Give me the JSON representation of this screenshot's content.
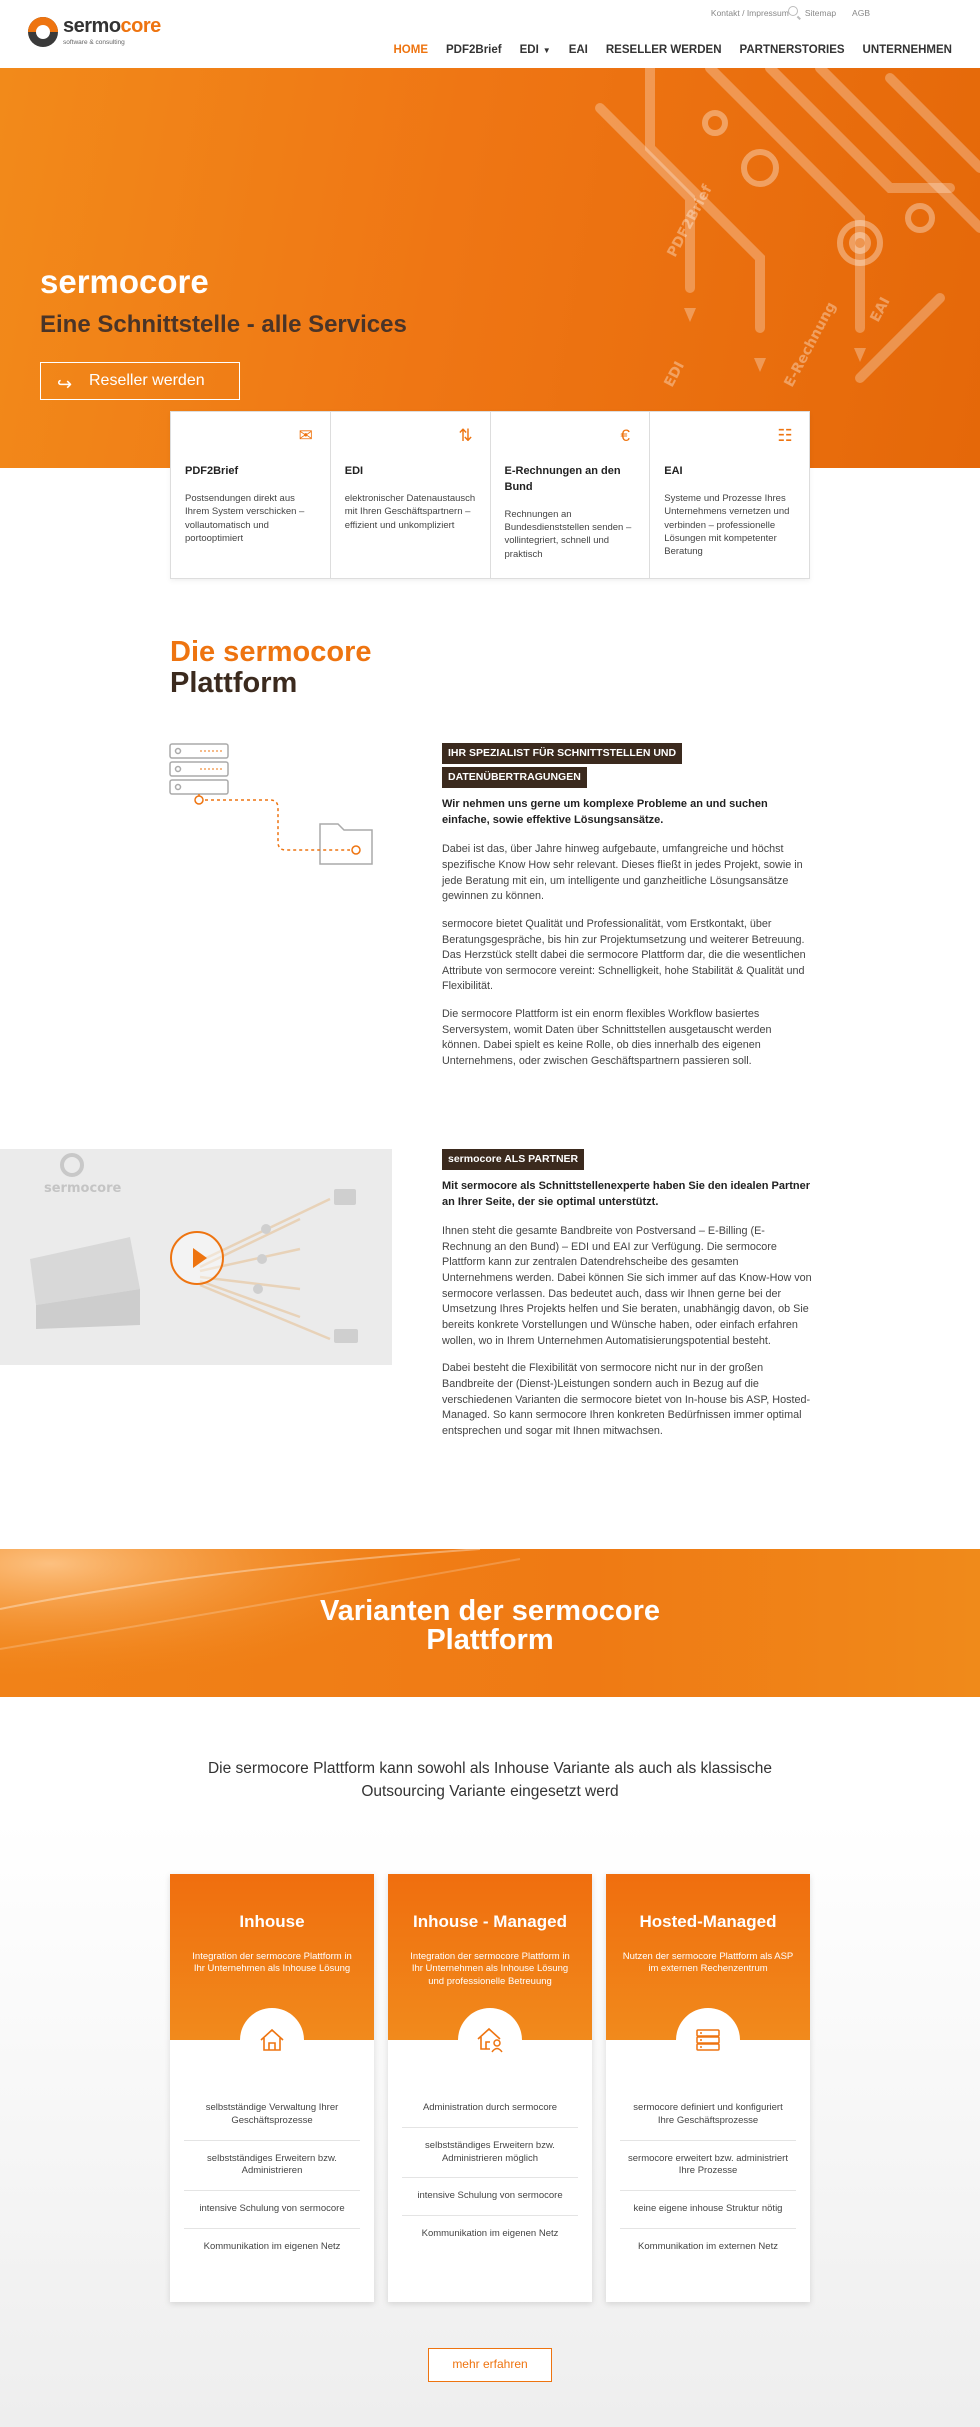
{
  "header": {
    "logo_main": "sermo",
    "logo_accent": "core",
    "logo_sub": "software & consulting",
    "util_links": [
      "Kontakt / Impressum",
      "Sitemap",
      "AGB"
    ],
    "nav": [
      {
        "label": "HOME",
        "active": true
      },
      {
        "label": "PDF2Brief"
      },
      {
        "label": "EDI",
        "has_dropdown": true
      },
      {
        "label": "EAI"
      },
      {
        "label": "RESELLER WERDEN"
      },
      {
        "label": "PARTNERSTORIES"
      },
      {
        "label": "UNTERNEHMEN"
      }
    ]
  },
  "hero": {
    "title": "sermocore",
    "subtitle": "Eine Schnittstelle - alle Services",
    "button": "Reseller werden",
    "graphic_labels": [
      "PDF2Brief",
      "EAI",
      "EDI",
      "E-Rechnung"
    ]
  },
  "services": [
    {
      "icon": "envelope-icon",
      "title": "PDF2Brief",
      "text": "Postsendungen direkt aus Ihrem System verschicken – vollautomatisch und portooptimiert"
    },
    {
      "icon": "shuffle-icon",
      "title": "EDI",
      "text": "elektronischer Datenaustausch mit Ihren Geschäftspartnern – effizient und unkompliziert"
    },
    {
      "icon": "euro-icon",
      "title": "E-Rechnungen an den Bund",
      "text": "Rechnungen an Bundesdienststellen senden – vollintegriert, schnell und praktisch"
    },
    {
      "icon": "network-icon",
      "title": "EAI",
      "text": "Systeme und Prozesse Ihres Unternehmens vernetzen und verbinden – professionelle Lösungen mit kompetenter Beratung"
    }
  ],
  "platform": {
    "title_line1": "Die sermocore",
    "title_line2": "Plattform",
    "spec_tag_line1": "IHR SPEZIALIST FÜR SCHNITTSTELLEN UND",
    "spec_tag_line2": "DATENÜBERTRAGUNGEN",
    "spec_lead": "Wir nehmen uns gerne um komplexe Probleme an und suchen einfache, sowie effektive Lösungsansätze.",
    "spec_paragraphs": [
      "Dabei ist das, über Jahre hinweg aufgebaute, umfangreiche und höchst spezifische Know How sehr relevant. Dieses fließt in jedes Projekt, sowie in jede Beratung mit ein, um intelligente und ganzheitliche Lösungsansätze gewinnen zu können.",
      "sermocore bietet Qualität und Professionalität, vom Erstkontakt, über Beratungsgespräche, bis hin zur Projektumsetzung und weiterer Betreuung. Das Herzstück stellt dabei die sermocore Plattform dar, die die wesentlichen Attribute von sermocore vereint: Schnelligkeit, hohe Stabilität & Qualität und Flexibilität.",
      "Die sermocore Plattform ist ein enorm flexibles Workflow basiertes Serversystem, womit Daten über Schnittstellen ausgetauscht werden können. Dabei spielt es keine Rolle, ob dies innerhalb des eigenen Unternehmens, oder zwischen Geschäftspartnern passieren soll."
    ],
    "partner_tag": "sermocore ALS PARTNER",
    "partner_lead": "Mit sermocore als Schnittstellenexperte haben Sie den idealen Partner an Ihrer Seite, der sie optimal unterstützt.",
    "partner_paragraphs": [
      "Ihnen steht die gesamte Bandbreite von Postversand – E-Billing (E-Rechnung an den Bund) – EDI und EAI zur Verfügung. Die sermocore Plattform kann zur zentralen Datendrehscheibe des gesamten Unternehmens werden. Dabei können Sie sich immer auf das Know-How von sermocore verlassen. Das bedeutet auch, dass wir Ihnen gerne bei der Umsetzung Ihres Projekts helfen und Sie beraten, unabhängig davon, ob Sie bereits konkrete Vorstellungen und Wünsche haben, oder einfach erfahren wollen, wo in Ihrem Unternehmen Automatisierungspotential besteht.",
      "Dabei besteht die Flexibilität von sermocore nicht nur in der großen Bandbreite der (Dienst-)Leistungen sondern auch in Bezug auf die verschiedenen Varianten die sermocore bietet von In-house bis ASP, Hosted-Managed. So kann sermocore Ihren konkreten Bedürfnissen immer optimal entsprechen und sogar mit Ihnen mitwachsen."
    ],
    "video_logo": "sermocore"
  },
  "variants_section": {
    "title_line1": "Varianten der sermocore",
    "title_line2": "Plattform",
    "intro": "Die sermocore Plattform kann sowohl als Inhouse Variante als auch als klassische Outsourcing Variante eingesetzt werd",
    "cards": [
      {
        "title": "Inhouse",
        "icon": "house-icon",
        "desc": "Integration der sermocore Plattform in Ihr Unternehmen als Inhouse Lösung",
        "items": [
          "selbstständige Verwaltung Ihrer Geschäftsprozesse",
          "selbstständiges Erweitern bzw. Administrieren",
          "intensive Schulung von sermocore",
          "Kommunikation im eigenen Netz"
        ]
      },
      {
        "title": "Inhouse - Managed",
        "icon": "house-user-icon",
        "desc": "Integration der sermocore Plattform in Ihr Unternehmen als Inhouse Lösung und professionelle Betreuung",
        "items": [
          "Administration durch sermocore",
          "selbstständiges Erweitern bzw. Administrieren möglich",
          "intensive Schulung von sermocore",
          "Kommunikation im eigenen Netz"
        ]
      },
      {
        "title": "Hosted-Managed",
        "icon": "server-icon",
        "desc": "Nutzen der sermocore Plattform als ASP im externen Rechenzentrum",
        "items": [
          "sermocore definiert und konfiguriert Ihre Geschäftsprozesse",
          "sermocore erweitert bzw. administriert Ihre Prozesse",
          "keine eigene inhouse Struktur nötig",
          "Kommunikation im externen Netz"
        ]
      }
    ],
    "more_button": "mehr erfahren"
  },
  "colors": {
    "accent": "#ee7410",
    "dark": "#3b2a1e"
  }
}
